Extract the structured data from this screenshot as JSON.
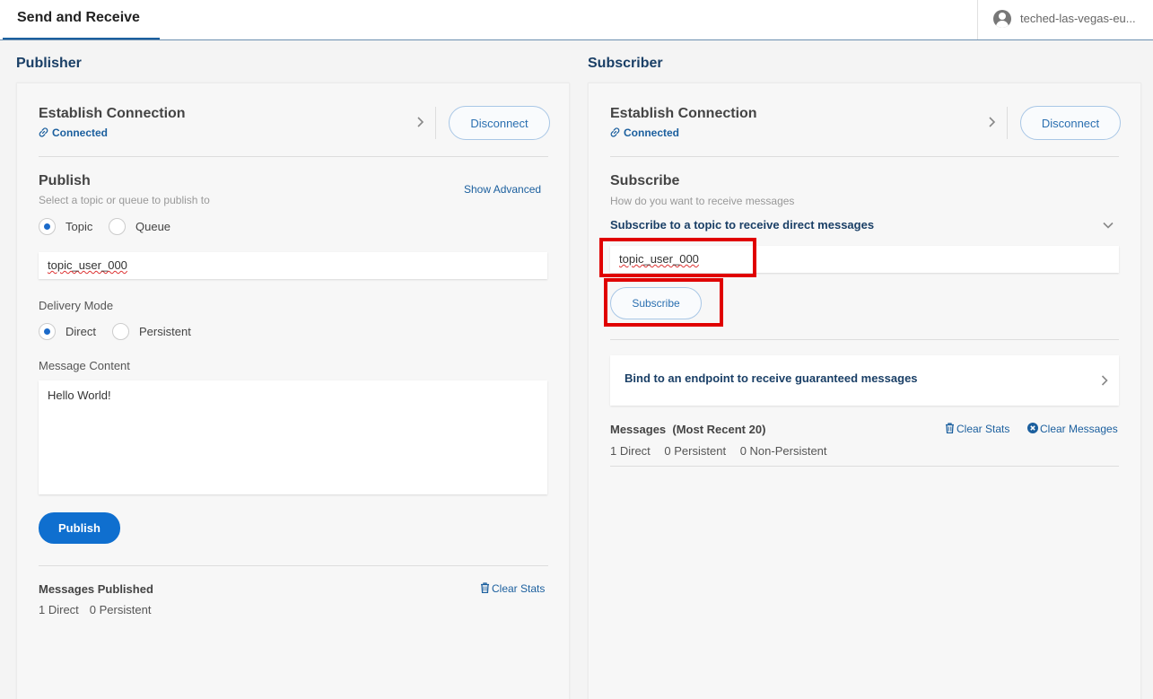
{
  "header": {
    "tab_label": "Send and Receive",
    "user_name": "teched-las-vegas-eu..."
  },
  "publisher": {
    "section_title": "Publisher",
    "connection": {
      "title": "Establish Connection",
      "status": "Connected",
      "disconnect_label": "Disconnect"
    },
    "publish": {
      "title": "Publish",
      "subtitle": "Select a topic or queue to publish to",
      "show_advanced": "Show Advanced",
      "dest_options": [
        "Topic",
        "Queue"
      ],
      "dest_selected": "Topic",
      "topic_value": "topic_user_000",
      "delivery_mode_label": "Delivery Mode",
      "delivery_options": [
        "Direct",
        "Persistent"
      ],
      "delivery_selected": "Direct",
      "message_content_label": "Message Content",
      "message_content": "Hello World!",
      "publish_button": "Publish"
    },
    "stats": {
      "title": "Messages Published",
      "clear_stats": "Clear Stats",
      "direct": "1 Direct",
      "persistent": "0 Persistent"
    }
  },
  "subscriber": {
    "section_title": "Subscriber",
    "connection": {
      "title": "Establish Connection",
      "status": "Connected",
      "disconnect_label": "Disconnect"
    },
    "subscribe": {
      "title": "Subscribe",
      "subtitle": "How do you want to receive messages",
      "direct_heading": "Subscribe to a topic to receive direct messages",
      "topic_value": "topic_user_000",
      "subscribe_button": "Subscribe",
      "bind_heading": "Bind to an endpoint to receive guaranteed messages"
    },
    "messages": {
      "title": "Messages",
      "title_suffix": "(Most Recent 20)",
      "clear_stats": "Clear Stats",
      "clear_messages": "Clear Messages",
      "direct": "1 Direct",
      "persistent": "0 Persistent",
      "non_persistent": "0 Non-Persistent"
    }
  },
  "colors": {
    "accent": "#1b5f9e",
    "primary_button": "#0f6fcf",
    "highlight": "#e00000"
  }
}
